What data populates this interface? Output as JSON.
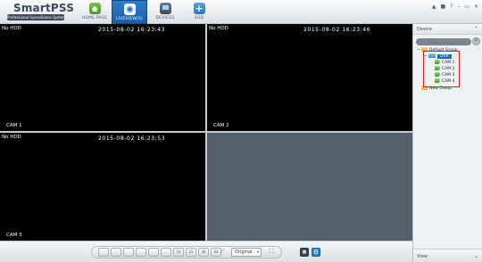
{
  "logo": {
    "main": "SmartPSS",
    "sub": "Professional Surveillance System"
  },
  "nav": {
    "home": "HOME PAGE",
    "live": "LIVEVIEW(S)",
    "devices": "DEVICES",
    "add": "ADD",
    "add_glyph": "+"
  },
  "window_controls": {
    "a": "▲",
    "b": "■",
    "help": "?",
    "min": "–",
    "restore": "▭",
    "close": "✕"
  },
  "panes": [
    {
      "hdd": "No HDD",
      "timestamp": "2015-08-02 16:23:43",
      "camera": "CAM 1"
    },
    {
      "hdd": "No HDD",
      "timestamp": "2015-08-02 16:23:46",
      "camera": "CAM 2"
    },
    {
      "hdd": "No HDD",
      "timestamp": "2015-08-02 16:23:53",
      "camera": "CAM 3"
    }
  ],
  "toolbar": {
    "split_labels": [
      "",
      "",
      "",
      "",
      "",
      "",
      "",
      "16",
      "25",
      "36",
      "64"
    ],
    "stream": "Original",
    "stream_caret": "▾",
    "fullscreen": "⛶",
    "save": "■",
    "settings": "⚙"
  },
  "sidepanel": {
    "title": "Device",
    "chevron_up": "⌃",
    "search_placeholder": "Please input key words",
    "search_icon": "⚲",
    "tree": {
      "root": "Default Group",
      "device": "DVR",
      "cameras": [
        "CAM 1",
        "CAM 2",
        "CAM 3",
        "CAM 4"
      ],
      "new_group": "New Group"
    },
    "footer": "View",
    "chevron_down": "⌄"
  },
  "colors": {
    "accent": "#1f67c5",
    "highlight": "#e21b1b",
    "video_bg": "#000000",
    "empty_pane": "#56606a"
  }
}
